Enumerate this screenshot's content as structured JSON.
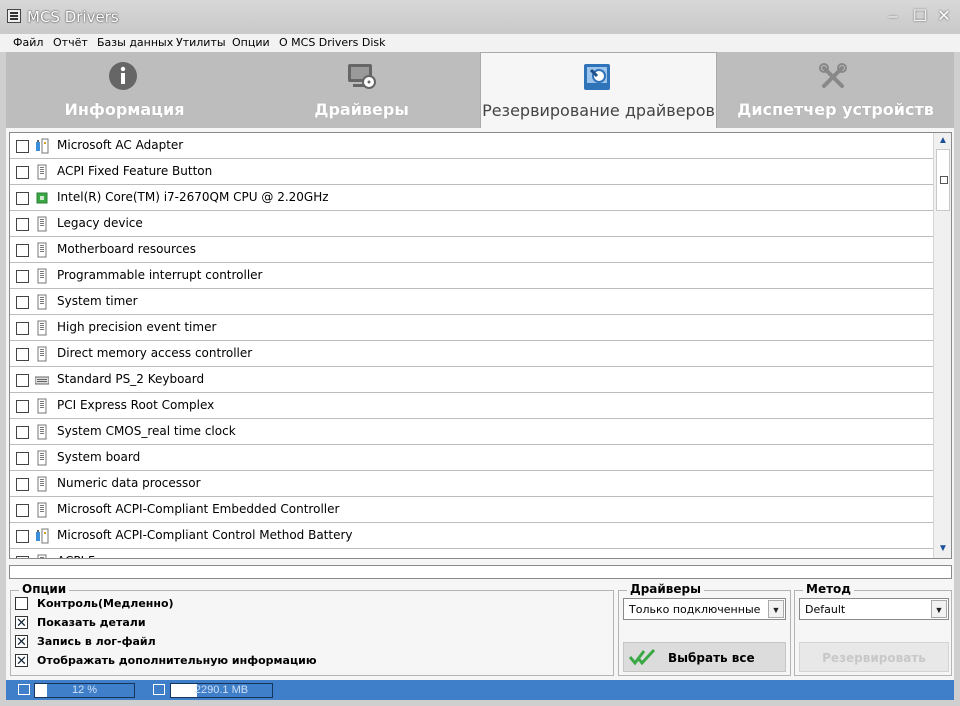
{
  "window": {
    "title": "MCS Drivers",
    "controls": {
      "minimize": "–",
      "maximize": "☐",
      "close": "✕"
    }
  },
  "menu": [
    "Файл",
    "Отчёт",
    "Базы данных",
    "Утилиты",
    "Опции",
    "O MCS Drivers Disk"
  ],
  "tabs": [
    {
      "label": "Информация",
      "icon": "info-icon",
      "active": false
    },
    {
      "label": "Драйверы",
      "icon": "driver-disk-icon",
      "active": false
    },
    {
      "label": "Резервирование драйверов",
      "icon": "backup-icon",
      "active": true
    },
    {
      "label": "Диспетчер устройств",
      "icon": "tools-icon",
      "active": false
    }
  ],
  "devices": [
    {
      "name": "Microsoft AC Adapter",
      "icon": "battery-icon"
    },
    {
      "name": "ACPI Fixed Feature Button",
      "icon": "system-device-icon"
    },
    {
      "name": "Intel(R) Core(TM) i7-2670QM CPU @ 2.20GHz",
      "icon": "cpu-icon"
    },
    {
      "name": "Legacy device",
      "icon": "system-device-icon"
    },
    {
      "name": "Motherboard resources",
      "icon": "system-device-icon"
    },
    {
      "name": "Programmable interrupt controller",
      "icon": "system-device-icon"
    },
    {
      "name": "System timer",
      "icon": "system-device-icon"
    },
    {
      "name": "High precision event timer",
      "icon": "system-device-icon"
    },
    {
      "name": "Direct memory access controller",
      "icon": "system-device-icon"
    },
    {
      "name": "Standard PS_2 Keyboard",
      "icon": "keyboard-icon"
    },
    {
      "name": "PCI Express Root Complex",
      "icon": "system-device-icon"
    },
    {
      "name": "System CMOS_real time clock",
      "icon": "system-device-icon"
    },
    {
      "name": "System board",
      "icon": "system-device-icon"
    },
    {
      "name": "Numeric data processor",
      "icon": "system-device-icon"
    },
    {
      "name": "Microsoft ACPI-Compliant Embedded Controller",
      "icon": "system-device-icon"
    },
    {
      "name": "Microsoft ACPI-Compliant Control Method Battery",
      "icon": "battery-icon"
    },
    {
      "name": "ACPI F",
      "icon": "system-device-icon"
    }
  ],
  "options": {
    "title": "Опции",
    "items": [
      {
        "label": "Контроль(Медленно)",
        "checked": false
      },
      {
        "label": "Показать детали",
        "checked": true
      },
      {
        "label": "Запись в лог-файл",
        "checked": true
      },
      {
        "label": "Отображать дополнительную информацию",
        "checked": true
      }
    ],
    "check_mark": "✕"
  },
  "drivers_group": {
    "title": "Драйверы",
    "select_value": "Только подключенные",
    "select_arrow": "▼",
    "select_all_label": "Выбрать все"
  },
  "method_group": {
    "title": "Метод",
    "select_value": "Default",
    "select_arrow": "▼",
    "backup_label": "Резервировать"
  },
  "scrollbar": {
    "up": "▲",
    "down": "▼"
  },
  "status": {
    "cpu_text": "12 %",
    "cpu_fraction": 0.12,
    "mem_text": "2290.1 MB",
    "mem_fraction": 0.26
  },
  "colors": {
    "status_blue": "#3f7ec8",
    "tab_bg": "#bdbdbd",
    "check_green": "#3aa845"
  }
}
